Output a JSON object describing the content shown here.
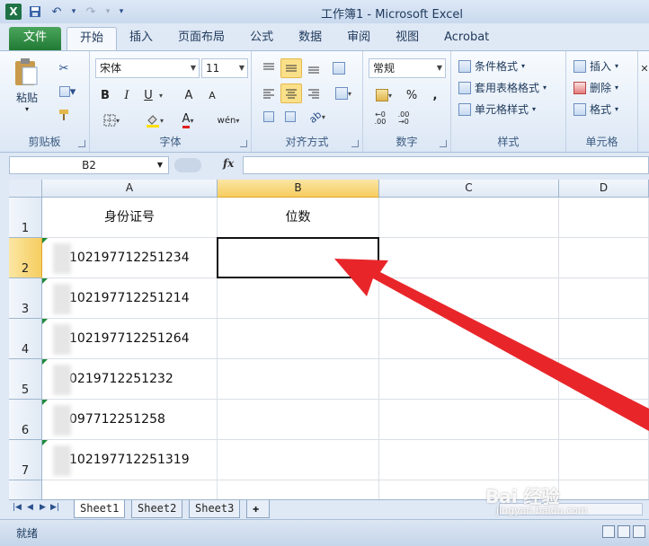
{
  "window": {
    "title": "工作簿1 - Microsoft Excel",
    "app_icon": "X"
  },
  "qat": {
    "undo_glyph": "↶",
    "redo_glyph": "↷",
    "dropdown_glyph": "▾",
    "save_glyph": "▪"
  },
  "tabs": [
    "文件",
    "开始",
    "插入",
    "页面布局",
    "公式",
    "数据",
    "审阅",
    "视图",
    "Acrobat"
  ],
  "ribbon": {
    "clipboard": {
      "label": "剪贴板",
      "paste": "粘贴"
    },
    "font": {
      "label": "字体",
      "name": "宋体",
      "size": "11",
      "bold": "B",
      "italic": "I",
      "underline": "U",
      "grow": "A",
      "shrink": "A",
      "font_color": "A",
      "wen": "wén"
    },
    "alignment": {
      "label": "对齐方式"
    },
    "number": {
      "label": "数字",
      "format": "常规",
      "percent": "%",
      "comma": ","
    },
    "styles": {
      "label": "样式",
      "conditional": "条件格式",
      "table": "套用表格格式",
      "cell": "单元格样式"
    },
    "cells": {
      "label": "单元格",
      "insert": "插入",
      "delete": "删除",
      "format": "格式"
    }
  },
  "formula_bar": {
    "name_box": "B2",
    "fx": "fx",
    "formula": ""
  },
  "grid": {
    "columns": [
      "A",
      "B",
      "C",
      "D"
    ],
    "selected_column": "B",
    "rows": [
      "1",
      "2",
      "3",
      "4",
      "5",
      "6",
      "7"
    ],
    "selected_row": "2",
    "header_row": [
      "身份证号",
      "位数"
    ],
    "ids": [
      "102197712251234",
      "102197712251214",
      "102197712251264",
      "0219712251232",
      "097712251258",
      "102197712251319"
    ]
  },
  "sheets": [
    "Sheet1",
    "Sheet2",
    "Sheet3"
  ],
  "active_sheet": "Sheet1",
  "status": {
    "ready": "就绪"
  },
  "watermark": {
    "brand": "Bai 经验",
    "url": "jingyan.baidu.com"
  },
  "colors": {
    "file_tab": "#217a34",
    "selection_header": "#f6cd60",
    "arrow": "#e8262a"
  }
}
